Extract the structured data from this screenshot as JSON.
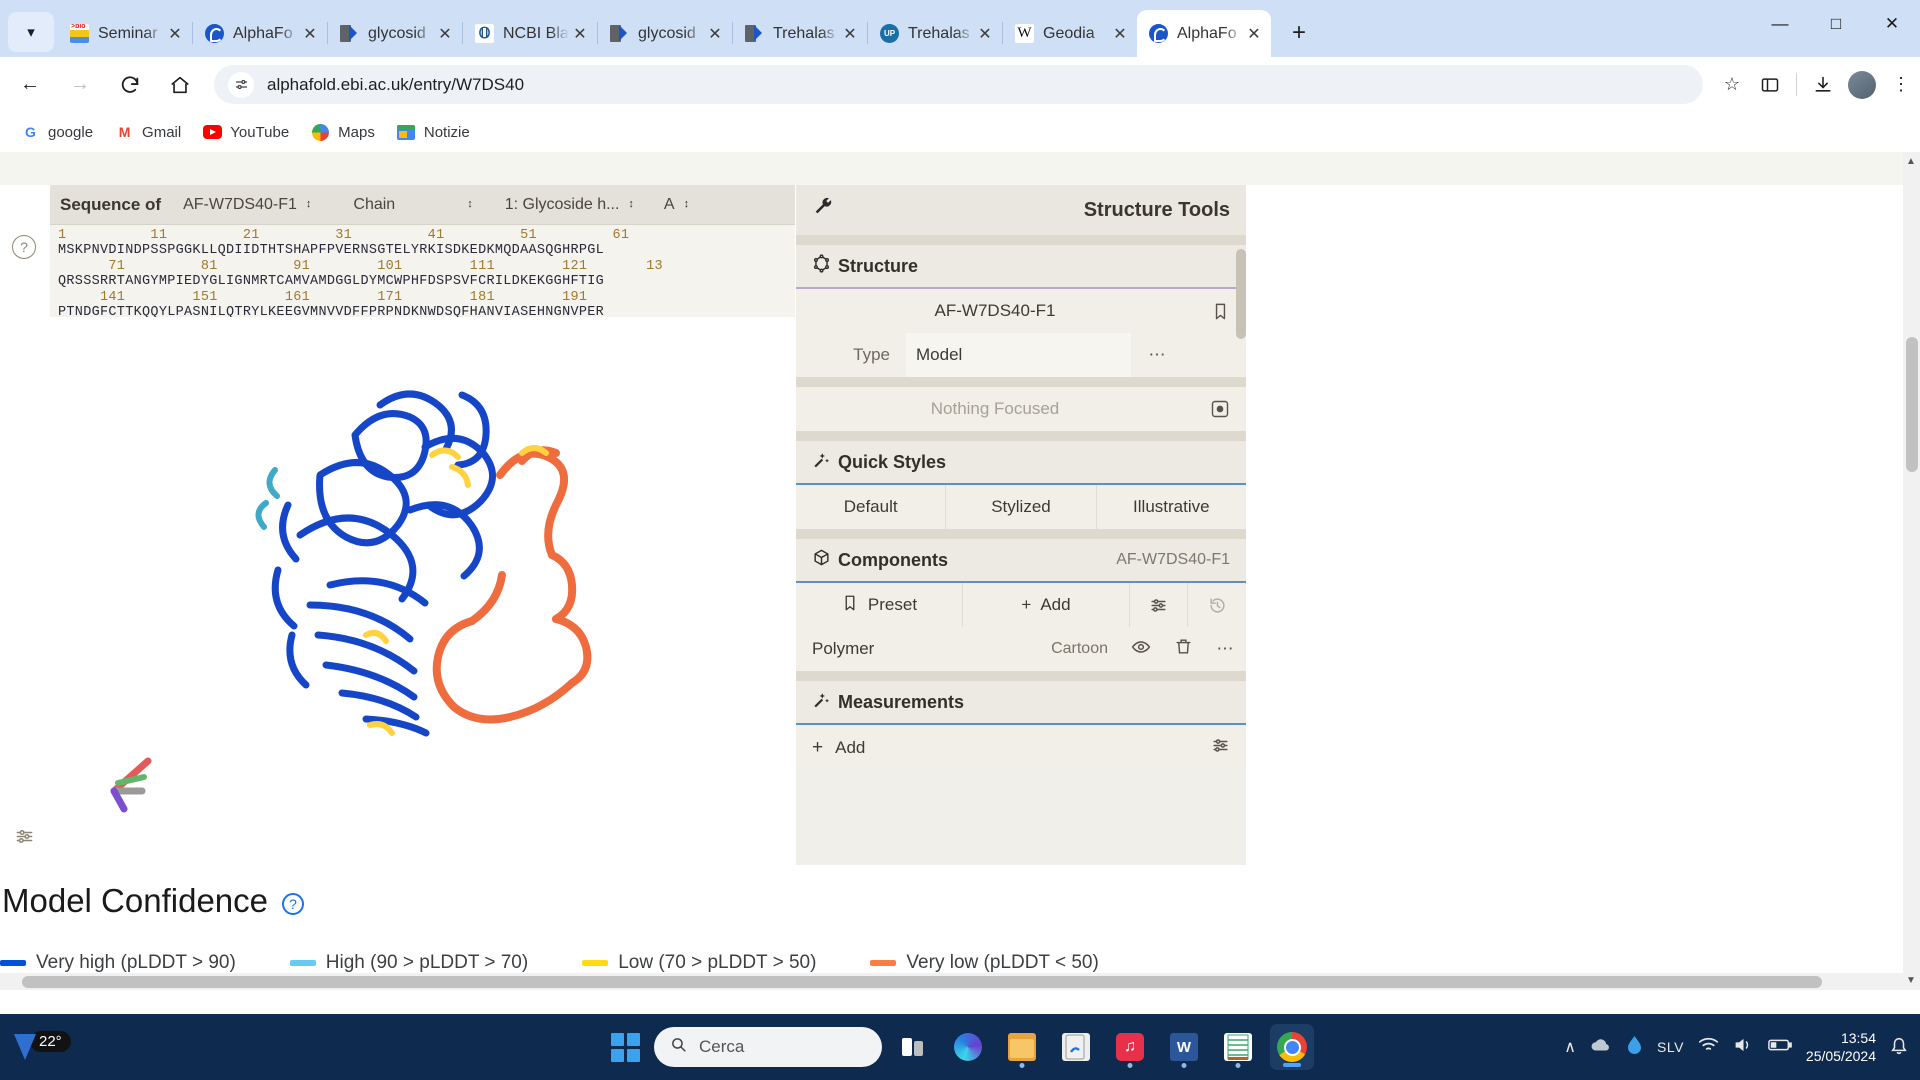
{
  "browser": {
    "tabs": [
      {
        "title": "Seminar",
        "favicon": "bio-icon",
        "active": false
      },
      {
        "title": "AlphaFo",
        "favicon": "alphafold-icon",
        "active": false
      },
      {
        "title": "glycosid",
        "favicon": "pdf-icon",
        "active": false
      },
      {
        "title": "NCBI Bla",
        "favicon": "ncbi-icon",
        "active": false
      },
      {
        "title": "glycosid",
        "favicon": "pdf-icon",
        "active": false
      },
      {
        "title": "Trehalas",
        "favicon": "pdf-icon",
        "active": false
      },
      {
        "title": "Trehalas",
        "favicon": "uniprot-icon",
        "active": false
      },
      {
        "title": "Geodia",
        "favicon": "wikipedia-icon",
        "active": false
      },
      {
        "title": "AlphaFo",
        "favicon": "alphafold-icon",
        "active": true
      }
    ],
    "tab_close_label": "✕",
    "new_tab_label": "+",
    "window_controls": {
      "minimize": "—",
      "maximize": "☐",
      "close": "✕"
    },
    "nav": {
      "back": "←",
      "forward": "→",
      "reload": "⟳",
      "home": "⌂"
    },
    "url": "alphafold.ebi.ac.uk/entry/W7DS40",
    "toolbar_icons": {
      "bookmark_star": "☆",
      "extensions": "⧉",
      "downloads": "⬇",
      "menu": "⋮"
    },
    "bookmarks": [
      {
        "label": "google",
        "icon": "google-icon"
      },
      {
        "label": "Gmail",
        "icon": "gmail-icon"
      },
      {
        "label": "YouTube",
        "icon": "youtube-icon"
      },
      {
        "label": "Maps",
        "icon": "maps-icon"
      },
      {
        "label": "Notizie",
        "icon": "news-icon"
      }
    ]
  },
  "molstar": {
    "sequence_header": {
      "label": "Sequence of",
      "entry_select": "AF-W7DS40-F1",
      "chain_select": "Chain",
      "entity_select": "1: Glycoside h...",
      "chain_id_select": "A",
      "help_icon": "?",
      "caret": "↕"
    },
    "sequence": {
      "lines": [
        {
          "numbers": "1          11         21         31         41         51         61",
          "residues": "MSKPNVDINDPSSPGGKLLQDIIDTHTSHAPFPVERNSGTELYRKISDKEDKMQDAASQGHRPGL"
        },
        {
          "numbers": "      71         81         91        101        111        121       13",
          "residues": "QRSSSRRTANGYMPIEDYGLIGNMRTCAMVAMDGGLDYMCWPHFDSPSVFCRILDKEKGGHFTIG"
        },
        {
          "numbers": "     141        151        161        171        181        191",
          "residues": "PTNDGFCTTKQQYLPASNILQTRYLKEEGVMNVVDFFPRPNDKNWDSQFHANVIASEHNGNVPER"
        }
      ]
    },
    "viewer_tools": [
      {
        "name": "reset-camera-icon",
        "glyph": "↺"
      },
      {
        "name": "screenshot-icon",
        "glyph": "◎"
      },
      {
        "name": "settings-wrench-icon",
        "glyph": "⚒"
      },
      {
        "name": "fullscreen-icon",
        "glyph": "⛶"
      },
      {
        "name": "sliders-icon",
        "glyph": "☰"
      },
      {
        "name": "select-cursor-icon",
        "glyph": "➤"
      }
    ],
    "left_help_icon": "?",
    "left_settings_icon": "☲"
  },
  "structure_tools": {
    "title": "Structure Tools",
    "wrench_icon": "🔧",
    "structure": {
      "section_title": "Structure",
      "section_icon": "hexagon-icon",
      "name": "AF-W7DS40-F1",
      "bookmark_icon": "□",
      "type_label": "Type",
      "type_value": "Model",
      "more_icon": "⋯",
      "focus_text": "Nothing Focused",
      "focus_icon": "⦿"
    },
    "quick_styles": {
      "section_title": "Quick Styles",
      "section_icon": "magic-wand-icon",
      "options": [
        "Default",
        "Stylized",
        "Illustrative"
      ]
    },
    "components": {
      "section_title": "Components",
      "section_icon": "cube-icon",
      "badge": "AF-W7DS40-F1",
      "preset_label": "Preset",
      "preset_icon": "bookmark-icon",
      "add_label": "Add",
      "add_icon": "+",
      "options_icon": "☷",
      "history_icon": "↺",
      "rows": [
        {
          "name": "Polymer",
          "representation": "Cartoon",
          "visibility_icon": "eye-icon",
          "delete_icon": "trash-icon",
          "more_icon": "⋯"
        }
      ]
    },
    "measurements": {
      "section_title": "Measurements",
      "section_icon": "magic-wand-icon",
      "add_label": "Add",
      "add_icon": "+",
      "options_icon": "☷"
    }
  },
  "model_confidence": {
    "title": "Model Confidence",
    "help_icon": "?",
    "legend": [
      {
        "label": "Very high (pLDDT > 90)",
        "color": "#0053d6"
      },
      {
        "label": "High (90 > pLDDT > 70)",
        "color": "#65cbf3"
      },
      {
        "label": "Low (70 > pLDDT > 50)",
        "color": "#ffdb13"
      },
      {
        "label": "Very low (pLDDT < 50)",
        "color": "#ff7d45"
      }
    ]
  },
  "taskbar": {
    "weather_temp": "22°",
    "search_placeholder": "Cerca",
    "search_icon": "search-icon",
    "start_icon": "windows-icon",
    "apps": [
      {
        "name": "task-view-icon"
      },
      {
        "name": "edge-icon"
      },
      {
        "name": "file-explorer-icon"
      },
      {
        "name": "pdf-reader-icon"
      },
      {
        "name": "music-icon"
      },
      {
        "name": "word-icon"
      },
      {
        "name": "excel-icon"
      },
      {
        "name": "chrome-icon"
      }
    ],
    "tray": {
      "chevron": "∧",
      "lang": "SLV",
      "wifi_icon": "wifi-icon",
      "volume_icon": "volume-icon",
      "battery_icon": "battery-icon",
      "time": "13:54",
      "date": "25/05/2024",
      "notification_icon": "bell-icon"
    }
  }
}
